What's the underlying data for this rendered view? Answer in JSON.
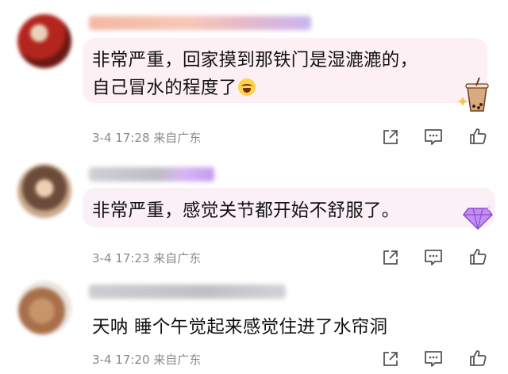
{
  "comments": [
    {
      "text_lines": [
        "非常严重，回家摸到那铁门是湿漉漉的，",
        "自己冒水的程度了"
      ],
      "emoji_icon": "laughing-crying-emoji",
      "meta": "3-4 17:28 来自广东",
      "decoration_icon": "milk-tea-sticker-icon",
      "bubble_color": "#fdf0f4"
    },
    {
      "text_lines": [
        "非常严重，感觉关节都开始不舒服了。"
      ],
      "meta": "3-4 17:23 来自广东",
      "decoration_icon": "purple-gem-sticker-icon",
      "bubble_color": "#faf0f6"
    },
    {
      "text_lines": [
        "天呐 睡个午觉起来感觉住进了水帘洞"
      ],
      "meta": "3-4 17:20 来自广东"
    }
  ],
  "actions": {
    "icons": [
      "share-icon",
      "comment-icon",
      "like-icon"
    ],
    "color": "#555555"
  }
}
